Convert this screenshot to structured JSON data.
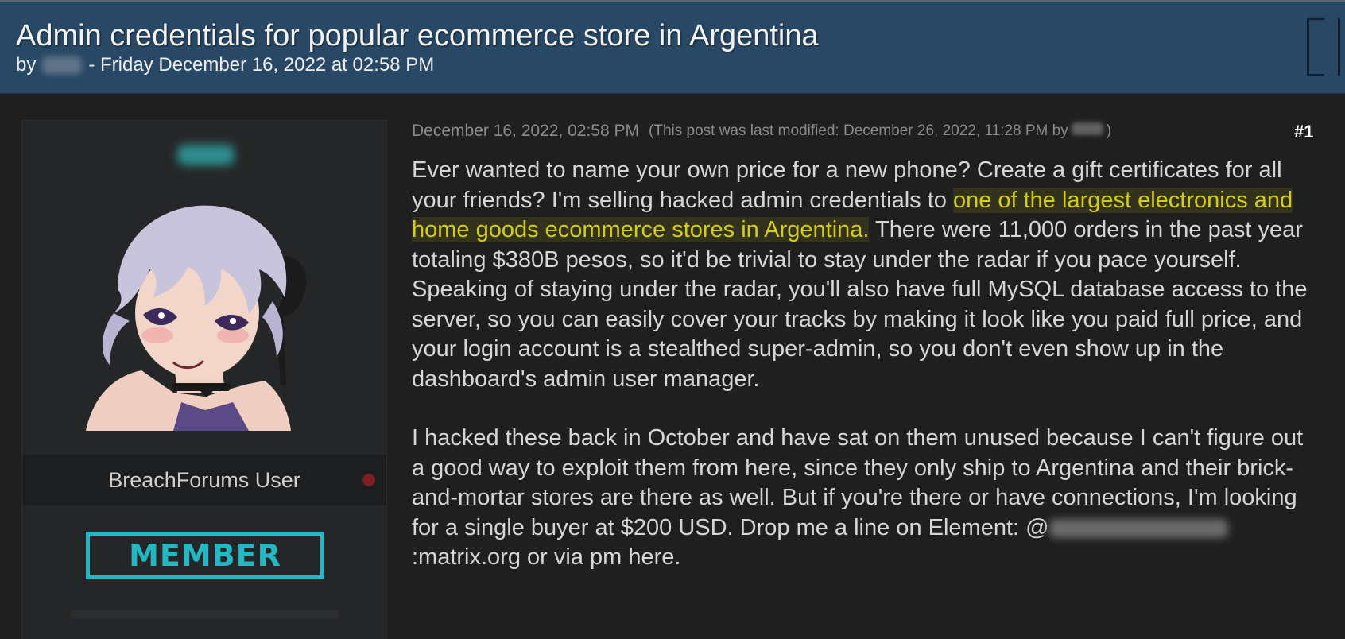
{
  "thread": {
    "title": "Admin credentials for popular ecommerce store in Argentina",
    "by_label": "by",
    "date_text": "- Friday December 16, 2022 at 02:58 PM"
  },
  "post": {
    "date": "December 16, 2022, 02:58 PM",
    "modified_prefix": "(This post was last modified: December 26, 2022, 11:28 PM by",
    "modified_suffix": ")",
    "number": "#1",
    "p1_before": "Ever wanted to name your own price for a new phone? Create a gift certificates for all your friends? I'm selling hacked admin credentials to ",
    "p1_highlight": "one of the largest electronics and home goods ecommerce stores in Argentina.",
    "p1_after": " There were 11,000 orders in the past year totaling $380B pesos, so it'd be trivial to stay under the radar if you pace yourself. Speaking of staying under the radar, you'll also have full MySQL database access to the server, so you can easily cover your tracks by making it look like you paid full price, and your login account is a stealthed super-admin, so you don't even show up in the dashboard's admin user manager.",
    "p2_before": "I hacked these back in October and have sat on them unused because I can't figure out a good way to exploit them from here, since they only ship to Argentina and their brick-and-mortar stores are there as well. But if you're there or have connections, I'm looking for a single buyer at $200 USD. Drop me a line on Element: @",
    "p2_after": ":matrix.org or via pm here."
  },
  "author": {
    "usertitle": "BreachForums User",
    "badge": "MEMBER",
    "status": "offline"
  },
  "colors": {
    "header_bg": "#284865",
    "page_bg": "#1f1f1f",
    "highlight": "#d4cc1c",
    "badge": "#24b7c4",
    "status_offline": "#7b1f24"
  },
  "icons": [
    "bracket-icon",
    "status-dot-icon"
  ]
}
